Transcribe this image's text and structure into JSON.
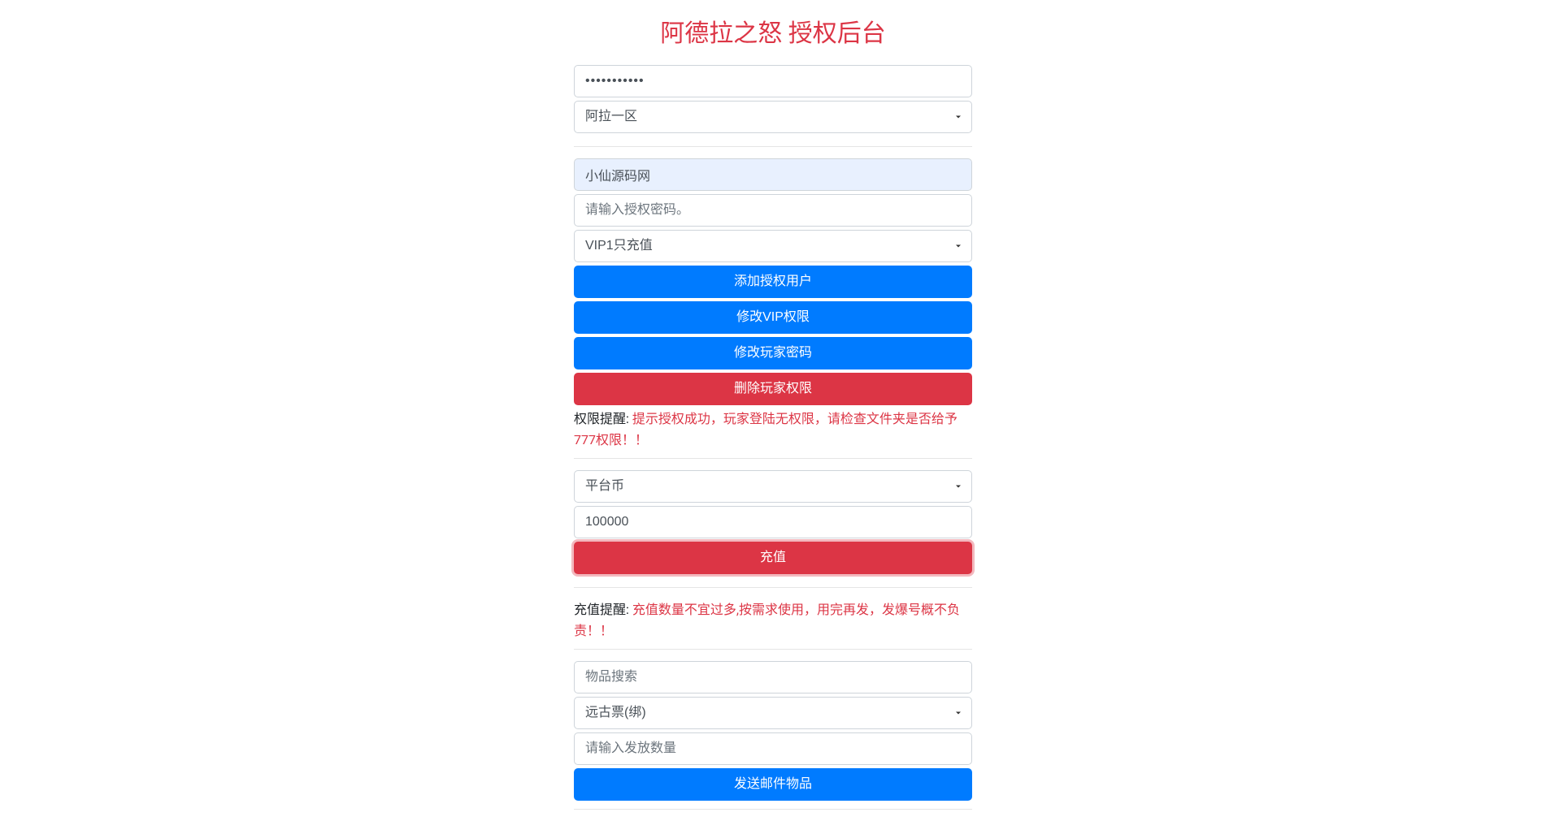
{
  "title": "阿德拉之怒 授权后台",
  "section1": {
    "password_value": "aaaaaaaaaaa",
    "server_select": "阿拉一区"
  },
  "section2": {
    "user_input": "小仙源码网",
    "auth_password_placeholder": "请输入授权密码。",
    "vip_select": "VIP1只充值",
    "btn_add_user": "添加授权用户",
    "btn_modify_vip": "修改VIP权限",
    "btn_modify_pw": "修改玩家密码",
    "btn_delete_user": "删除玩家权限",
    "perm_hint_label": "权限提醒: ",
    "perm_hint_text": "提示授权成功，玩家登陆无权限，请检查文件夹是否给予777权限！！"
  },
  "section3": {
    "currency_select": "平台币",
    "amount_value": "100000",
    "btn_recharge": "充值",
    "recharge_hint_label": "充值提醒: ",
    "recharge_hint_text": "充值数量不宜过多,按需求使用，用完再发，发爆号概不负责！！"
  },
  "section4": {
    "item_search_placeholder": "物品搜索",
    "item_select": "远古票(绑)",
    "qty_placeholder": "请输入发放数量",
    "btn_send_mail": "发送邮件物品"
  }
}
